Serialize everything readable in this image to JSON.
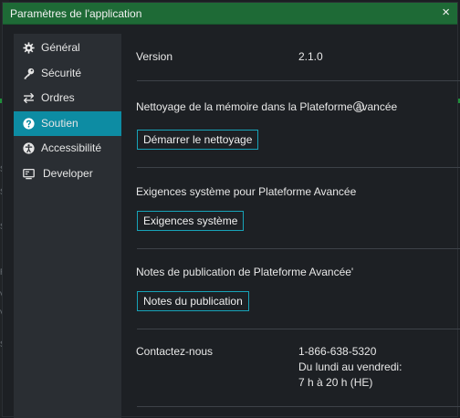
{
  "window": {
    "title": "Paramètres de l'application",
    "close_glyph": "×"
  },
  "background": {
    "ticks": [
      "S",
      "S",
      "S",
      "R",
      "V",
      "V",
      "S"
    ]
  },
  "sidebar": {
    "items": [
      {
        "label": "Général",
        "icon": "gear-icon",
        "active": false
      },
      {
        "label": "Sécurité",
        "icon": "key-icon",
        "active": false
      },
      {
        "label": "Ordres",
        "icon": "swap-arrows-icon",
        "active": false
      },
      {
        "label": "Soutien",
        "icon": "question-circle-icon",
        "active": true
      },
      {
        "label": "Accessibilité",
        "icon": "accessibility-icon",
        "active": false
      },
      {
        "label": "Developer",
        "icon": "monitor-icon",
        "active": false
      }
    ]
  },
  "main": {
    "version_label": "Version",
    "version_value": "2.1.0",
    "memory_label": "Nettoyage de la mémoire dans la Plateforme avancée",
    "memory_button": "Démarrer le nettoyage",
    "requirements_label": "Exigences système pour Plateforme Avancée",
    "requirements_button": "Exigences système",
    "release_label": "Notes de publication de Plateforme Avancée'",
    "release_button": "Notes du publication",
    "contact_label": "Contactez-nous",
    "contact_phone": "1-866-638-5320",
    "contact_days": "Du lundi au vendredi:",
    "contact_hours": "7 h à 20 h (HE)"
  },
  "colors": {
    "titlebar": "#1e6a36",
    "accent": "#0d8ca3",
    "button_border": "#17a3b8"
  }
}
